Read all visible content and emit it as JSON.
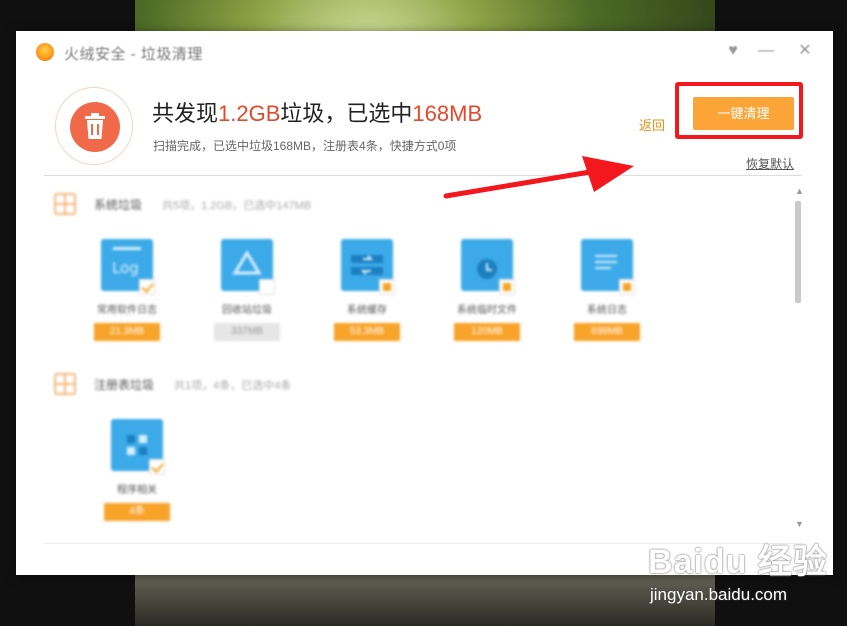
{
  "window": {
    "app_title": "火绒安全 - 垃圾清理",
    "controls": {
      "skin": "♥",
      "minimize": "—",
      "close": "✕"
    }
  },
  "header": {
    "headline_prefix": "共发现",
    "total_size": "1.2GB",
    "headline_mid": "垃圾，已选中",
    "selected_size": "168MB",
    "summary": "扫描完成，已选中垃圾168MB，注册表4条，快捷方式0项",
    "back_label": "返回",
    "clean_button_label": "一键清理",
    "restore_label": "恢复默认"
  },
  "sections": [
    {
      "title": "系统垃圾",
      "detail": "共5项，1.2GB，已选中147MB",
      "items": [
        {
          "label": "常用软件日志",
          "size": "21.3MB",
          "icon": "log-file-icon",
          "selected": "checked"
        },
        {
          "label": "回收站垃圾",
          "size": "337MB",
          "icon": "recycle-bin-icon",
          "selected": "unchecked"
        },
        {
          "label": "系统缓存",
          "size": "53.3MB",
          "icon": "system-cache-icon",
          "selected": "partial"
        },
        {
          "label": "系统临时文件",
          "size": "120MB",
          "icon": "temp-folder-icon",
          "selected": "partial"
        },
        {
          "label": "系统日志",
          "size": "698MB",
          "icon": "system-log-icon",
          "selected": "partial"
        }
      ]
    },
    {
      "title": "注册表垃圾",
      "detail": "共1项，4条，已选中4条",
      "items": [
        {
          "label": "程序相关",
          "size": "4条",
          "icon": "registry-icon",
          "selected": "checked"
        }
      ]
    }
  ],
  "watermark": {
    "brand": "Baidu 经验",
    "url": "jingyan.baidu.com"
  },
  "colors": {
    "accent_orange": "#fba437",
    "highlight_red": "#e4492a",
    "annotation_red": "#f2181e",
    "tile_blue": "#3caae8"
  }
}
